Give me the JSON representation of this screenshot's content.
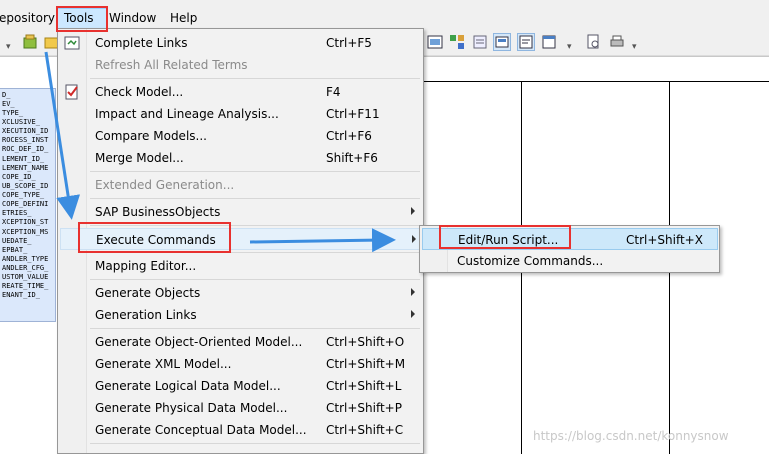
{
  "menubar": {
    "items": [
      "epository",
      "Tools",
      "Window",
      "Help"
    ]
  },
  "entity": {
    "rows": [
      "D_",
      "EV_",
      "TYPE_",
      "XCLUSIVE_",
      "XECUTION_ID",
      "ROCESS_INST",
      "ROC_DEF_ID_",
      "LEMENT_ID_",
      "LEMENT_NAME",
      "COPE_ID_",
      "UB_SCOPE_ID",
      "COPE_TYPE_",
      "COPE_DEFINI",
      "ETRIES_",
      "XCEPTION_ST",
      "XCEPTION_MS",
      "UEDATE_",
      "EPBAT_",
      "ANDLER_TYPE",
      "ANDLER_CFG_",
      "USTOM_VALUE",
      "REATE_TIME_",
      "ENANT_ID_"
    ]
  },
  "tools_menu": {
    "items": [
      {
        "label": "Complete Links",
        "shortcut": "Ctrl+F5",
        "disabled": false,
        "icon": "links-icon"
      },
      {
        "label": "Refresh All Related Terms",
        "shortcut": "",
        "disabled": true
      },
      {
        "label": "Check Model...",
        "shortcut": "F4",
        "disabled": false,
        "icon": "check-icon"
      },
      {
        "label": "Impact and Lineage Analysis...",
        "shortcut": "Ctrl+F11",
        "disabled": false
      },
      {
        "label": "Compare Models...",
        "shortcut": "Ctrl+F6",
        "disabled": false
      },
      {
        "label": "Merge Model...",
        "shortcut": "Shift+F6",
        "disabled": false
      },
      {
        "label": "Extended Generation...",
        "shortcut": "",
        "disabled": true
      },
      {
        "label": "SAP BusinessObjects",
        "shortcut": "",
        "disabled": false,
        "submenu": true
      },
      {
        "label": "Execute Commands",
        "shortcut": "",
        "disabled": false,
        "submenu": true
      },
      {
        "label": "Mapping Editor...",
        "shortcut": "",
        "disabled": false
      },
      {
        "label": "Generate Objects",
        "shortcut": "",
        "disabled": false,
        "submenu": true
      },
      {
        "label": "Generation Links",
        "shortcut": "",
        "disabled": false,
        "submenu": true
      },
      {
        "label": "Generate Object-Oriented Model...",
        "shortcut": "Ctrl+Shift+O",
        "disabled": false
      },
      {
        "label": "Generate XML Model...",
        "shortcut": "Ctrl+Shift+M",
        "disabled": false
      },
      {
        "label": "Generate Logical Data Model...",
        "shortcut": "Ctrl+Shift+L",
        "disabled": false
      },
      {
        "label": "Generate Physical Data Model...",
        "shortcut": "Ctrl+Shift+P",
        "disabled": false
      },
      {
        "label": "Generate Conceptual Data Model...",
        "shortcut": "Ctrl+Shift+C",
        "disabled": false
      }
    ]
  },
  "submenu": {
    "items": [
      {
        "label": "Edit/Run Script...",
        "shortcut": "Ctrl+Shift+X"
      },
      {
        "label": "Customize Commands...",
        "shortcut": ""
      }
    ]
  },
  "watermark": "https://blog.csdn.net/konnysnow",
  "colors": {
    "annotation": "#e8312f",
    "arrow": "#3b8de0",
    "menu_highlight": "#cde8fa",
    "entity_fill": "#dbe8fb"
  }
}
